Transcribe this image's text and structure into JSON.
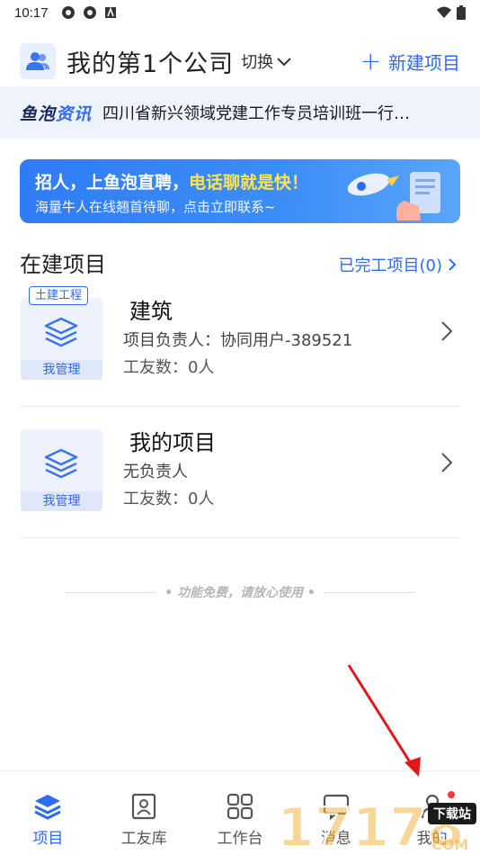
{
  "status_bar": {
    "time": "10:17"
  },
  "header": {
    "company_name": "我的第1个公司",
    "switch_label": "切换",
    "new_project_label": "新建项目"
  },
  "news": {
    "logo_part1": "鱼泡",
    "logo_part2": "资讯",
    "headline": "四川省新兴领域党建工作专员培训班一行…"
  },
  "banner": {
    "title_part1": "招人，上鱼泡直聘，",
    "title_highlight": "电话聊就是快！",
    "subtitle": "海量牛人在线翘首待聊，点击立即联系~"
  },
  "section": {
    "title": "在建项目",
    "completed_link": "已完工项目(0)"
  },
  "projects": [
    {
      "tag": "土建工程",
      "name": "建筑",
      "owner": "项目负责人：协同用户-389521",
      "workers": "工友数：0人",
      "manage_label": "我管理"
    },
    {
      "tag": "",
      "name": "我的项目",
      "owner": "无负责人",
      "workers": "工友数：0人",
      "manage_label": "我管理"
    }
  ],
  "free_note": "• 功能免费，请放心使用 •",
  "tabs": [
    {
      "label": "项目",
      "icon": "layers-icon",
      "active": true
    },
    {
      "label": "工友库",
      "icon": "contact-card-icon",
      "active": false
    },
    {
      "label": "工作台",
      "icon": "grid-icon",
      "active": false
    },
    {
      "label": "消息",
      "icon": "message-icon",
      "active": false
    },
    {
      "label": "我的",
      "icon": "person-icon",
      "active": false
    }
  ],
  "watermark": {
    "text": "17178",
    "badge": "下载站",
    "suffix": "COM"
  },
  "colors": {
    "accent": "#2e6bf0",
    "highlight": "#ffe44d",
    "badge_red": "#f23b3b",
    "news_bg": "#eef3fc"
  }
}
